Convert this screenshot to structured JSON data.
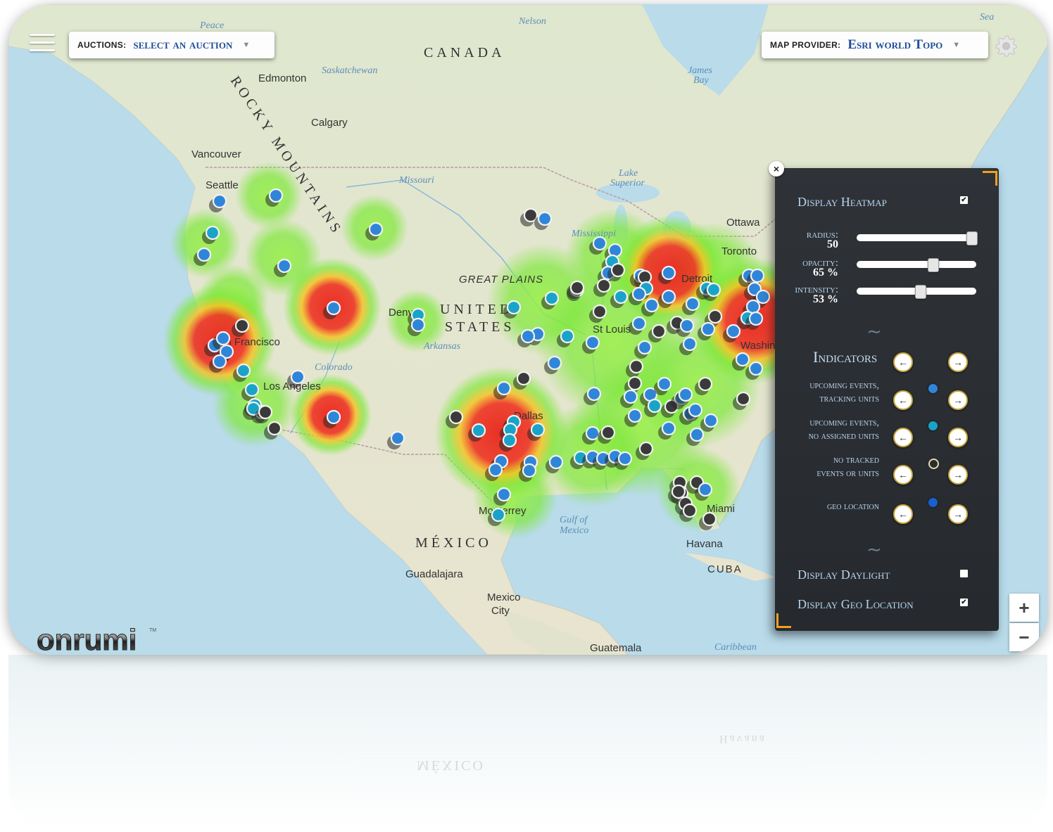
{
  "toolbar": {
    "auctions_label": "AUCTIONS:",
    "auctions_value": "select an auction",
    "provider_label": "MAP PROVIDER:",
    "provider_value": "Esri world Topo"
  },
  "map": {
    "country_labels": [
      "CANADA",
      "UNITED",
      "STATES",
      "MÉXICO",
      "CUBA"
    ],
    "region_labels": [
      "GREAT PLAINS",
      "ROCKY MOUNTAINS"
    ],
    "city_labels": [
      "Edmonton",
      "Calgary",
      "Vancouver",
      "Seattle",
      "San Francisco",
      "Los Angeles",
      "Denver",
      "St Louis",
      "Dallas",
      "Monterrey",
      "Guadalajara",
      "Mexico City",
      "Guatemala",
      "Havana",
      "Miami",
      "Ottawa",
      "Toronto",
      "Detroit",
      "Washington"
    ],
    "water_labels": [
      "Missouri",
      "Saskatchewan",
      "Nelson",
      "James Bay",
      "Lake Superior",
      "Gulf of Mexico",
      "Caribbean",
      "Sea",
      "Peace",
      "Arkansas",
      "Colorado",
      "Mississippi"
    ],
    "zoom_in": "+",
    "zoom_out": "−"
  },
  "panel": {
    "close": "×",
    "display_heatmap": "Display Heatmap",
    "heatmap_checked": "✔",
    "radius_label": "radius:",
    "radius_value": "50",
    "radius_level": 1.0,
    "opacity_label": "opacity:",
    "opacity_value": "65 %",
    "opacity_level": 0.65,
    "intensity_label": "intensity:",
    "intensity_value": "53 %",
    "intensity_level": 0.53,
    "flourish": "∼",
    "indicators_title": "Indicators",
    "prev_arrow": "←",
    "next_arrow": "→",
    "indicators": [
      {
        "label_1": "upcoming events,",
        "label_2": "tracking units",
        "color": "#2f86d8"
      },
      {
        "label_1": "upcoming events,",
        "label_2": "no assigned units",
        "color": "#1aa3c8"
      },
      {
        "label_1": "no tracked",
        "label_2": "events or units",
        "color": "#2f3338"
      },
      {
        "label_1": "",
        "label_2": "geo location",
        "color": "#1a5fd0"
      }
    ],
    "display_daylight": "Display Daylight",
    "daylight_checked": "",
    "display_geo": "Display Geo Location",
    "geo_checked": "✔"
  },
  "logo": {
    "text": "onrumi",
    "tm": "TM"
  },
  "colors": {
    "marker_blue": "#2f86d8",
    "marker_cyan": "#1aa3c8",
    "marker_dark": "#3a3a3a",
    "heat_green": "#7ee83a",
    "heat_red": "#ee3322",
    "accent_orange": "#f0a020"
  }
}
